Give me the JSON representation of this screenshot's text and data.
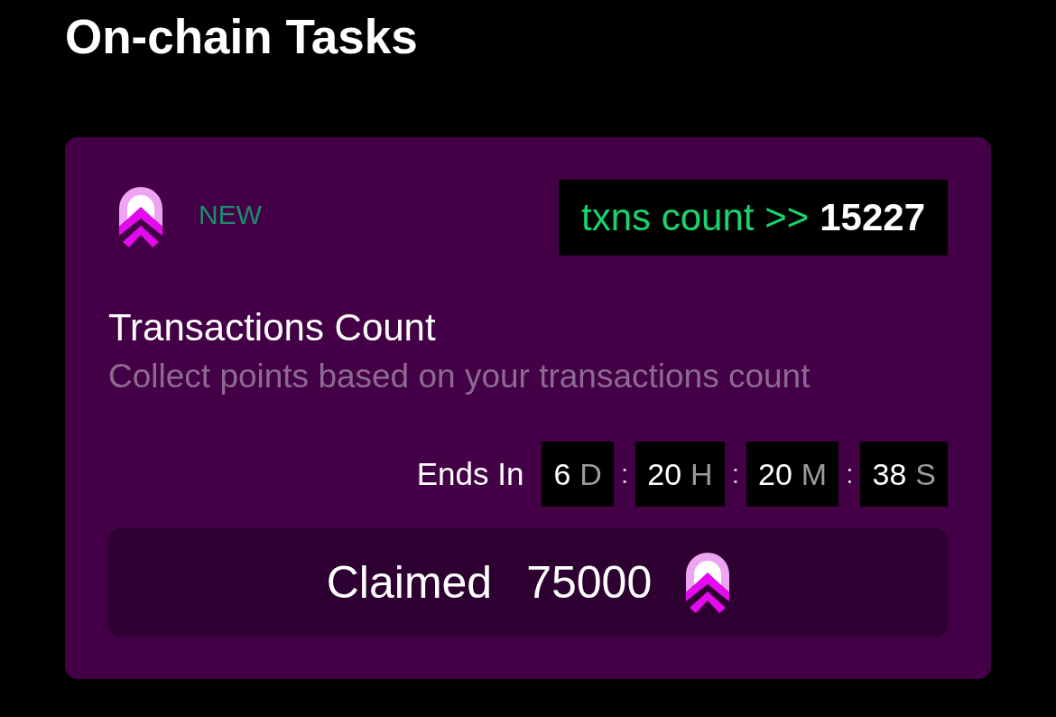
{
  "page": {
    "title": "On-chain Tasks"
  },
  "task": {
    "status_label": "NEW",
    "stat": {
      "label": "txns count >>",
      "value": "15227"
    },
    "title": "Transactions Count",
    "description": "Collect points based on your transactions count",
    "countdown": {
      "label": "Ends In",
      "parts": [
        {
          "kind": "segment",
          "value": "6",
          "unit": "D"
        },
        {
          "kind": "separator",
          "text": ":"
        },
        {
          "kind": "segment",
          "value": "20",
          "unit": "H"
        },
        {
          "kind": "separator",
          "text": ":"
        },
        {
          "kind": "segment",
          "value": "20",
          "unit": "M"
        },
        {
          "kind": "separator",
          "text": ":"
        },
        {
          "kind": "segment",
          "value": "38",
          "unit": "S"
        }
      ]
    },
    "claim_button": {
      "label": "Claimed",
      "amount": "75000"
    }
  }
}
